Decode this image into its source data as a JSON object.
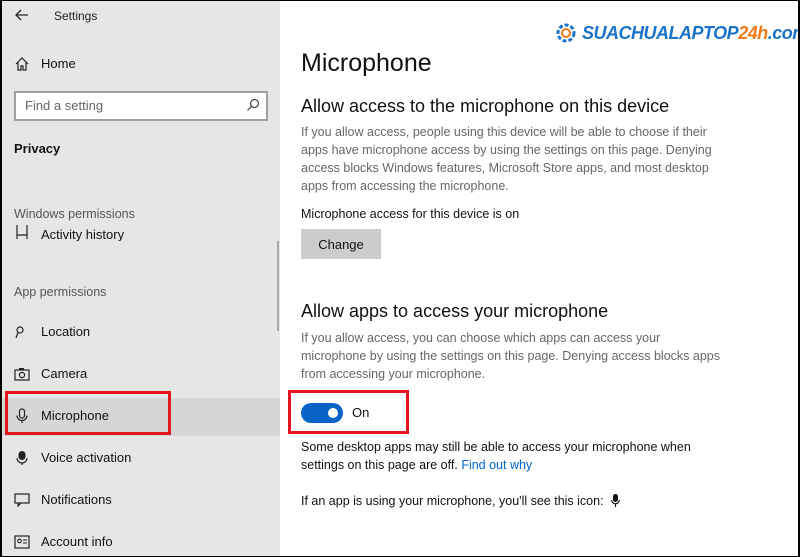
{
  "window": {
    "title": "Settings",
    "back_icon": "back-arrow-icon"
  },
  "sidebar": {
    "home_label": "Home",
    "search_placeholder": "Find a setting",
    "section_title": "Privacy",
    "windows_permissions_label": "Windows permissions",
    "partial_item_label": "Activity history",
    "app_permissions_label": "App permissions",
    "items": [
      {
        "label": "Location",
        "icon": "location-icon"
      },
      {
        "label": "Camera",
        "icon": "camera-icon"
      },
      {
        "label": "Microphone",
        "icon": "microphone-icon",
        "selected": true
      },
      {
        "label": "Voice activation",
        "icon": "voice-activation-icon"
      },
      {
        "label": "Notifications",
        "icon": "notifications-icon"
      },
      {
        "label": "Account info",
        "icon": "account-info-icon"
      }
    ]
  },
  "main": {
    "title": "Microphone",
    "device_section": {
      "heading": "Allow access to the microphone on this device",
      "description": "If you allow access, people using this device will be able to choose if their apps have microphone access by using the settings on this page. Denying access blocks Windows features, Microsoft Store apps, and most desktop apps from accessing the microphone.",
      "status": "Microphone access for this device is on",
      "change_button": "Change"
    },
    "apps_section": {
      "heading": "Allow apps to access your microphone",
      "description": "If you allow access, you can choose which apps can access your microphone by using the settings on this page. Denying access blocks apps from accessing your microphone.",
      "toggle_state": "On",
      "toggle_on": true,
      "note": "Some desktop apps may still be able to access your microphone when settings on this page are off.",
      "find_out_link": "Find out why",
      "icon_note": "If an app is using your microphone, you'll see this icon:"
    }
  },
  "watermark": {
    "text_main": "SUACHUALAPTOP",
    "text_accent": "24h",
    "text_suffix": ".com",
    "colors": {
      "main": "#1a73c9",
      "accent": "#f07a1a"
    }
  },
  "colors": {
    "accent": "#0a64c8",
    "highlight": "#e4151f",
    "link": "#0066cc"
  }
}
